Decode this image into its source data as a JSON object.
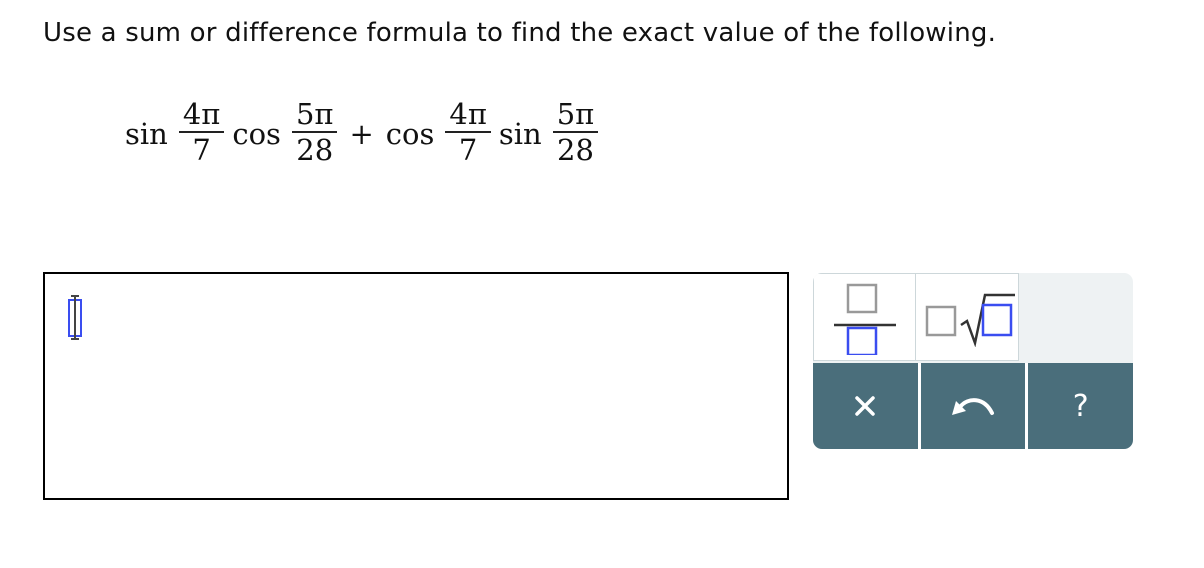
{
  "question": {
    "prompt": "Use a sum or difference formula to find the exact value of the following.",
    "expression": {
      "term1": {
        "fn1": "sin",
        "frac1_num": "4π",
        "frac1_den": "7",
        "fn2": "cos",
        "frac2_num": "5π",
        "frac2_den": "28"
      },
      "operator": "+",
      "term2": {
        "fn1": "cos",
        "frac1_num": "4π",
        "frac1_den": "7",
        "fn2": "sin",
        "frac2_num": "5π",
        "frac2_den": "28"
      }
    }
  },
  "answer": {
    "value": "",
    "cursor_icon": "input-cursor-placeholder-icon"
  },
  "palette": {
    "keys": [
      {
        "name": "fraction",
        "icon": "fraction-template-icon"
      },
      {
        "name": "mixed-radical",
        "icon": "radical-template-icon"
      }
    ],
    "actions": [
      {
        "name": "clear",
        "label": "×",
        "icon": "close-icon"
      },
      {
        "name": "undo",
        "icon": "undo-icon"
      },
      {
        "name": "help",
        "label": "?",
        "icon": "help-icon"
      }
    ],
    "colors": {
      "action_bar": "#4a6e7b",
      "active_slot": "#3a4df0",
      "inactive_slot": "#999999"
    }
  }
}
